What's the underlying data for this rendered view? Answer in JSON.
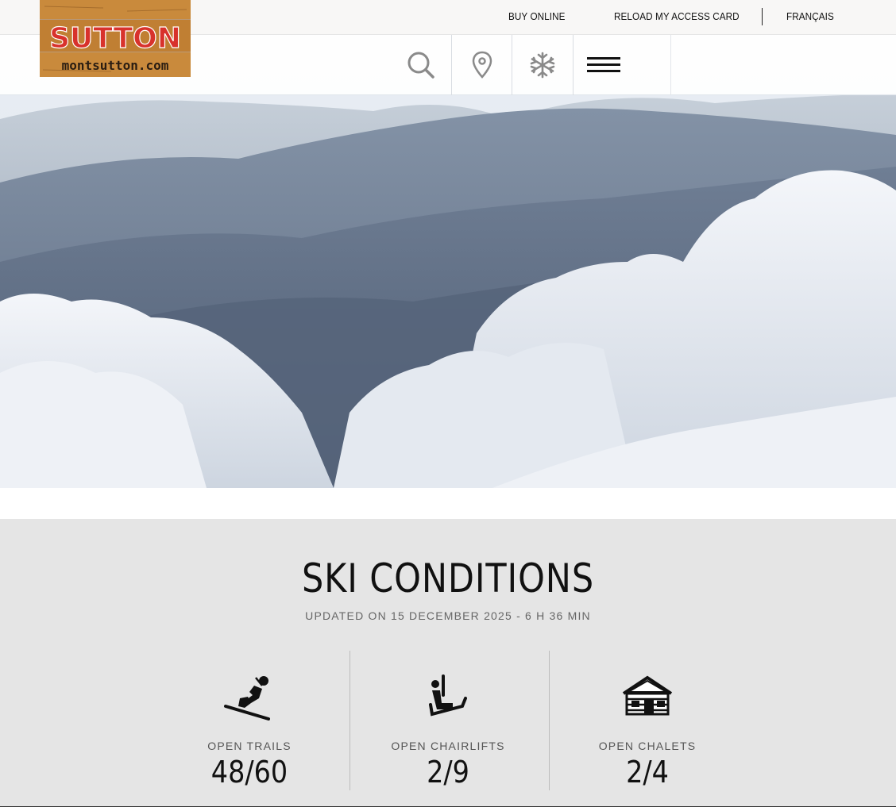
{
  "topbar": {
    "links": [
      "BUY ONLINE",
      "RELOAD MY ACCESS CARD",
      "FRANÇAIS"
    ]
  },
  "logo": {
    "brand": "SUTTON",
    "domain": "montsutton.com"
  },
  "nav": {
    "icons": [
      "search-icon",
      "map-pin-icon",
      "snowflake-icon",
      "hamburger-menu-icon"
    ]
  },
  "conditions": {
    "title": "SKI CONDITIONS",
    "updated": "UPDATED ON 15 DECEMBER 2025 - 6 H 36 MIN",
    "stats": [
      {
        "icon": "skier-icon",
        "label": "OPEN TRAILS",
        "value": "48/60"
      },
      {
        "icon": "chairlift-icon",
        "label": "OPEN CHAIRLIFTS",
        "value": "2/9"
      },
      {
        "icon": "chalet-icon",
        "label": "OPEN CHALETS",
        "value": "2/4"
      }
    ]
  },
  "colors": {
    "topbar_bg": "#f8f7f6",
    "conditions_bg": "#e5e5e5",
    "logo_red": "#d8322c",
    "wood": "#c98a3c"
  }
}
